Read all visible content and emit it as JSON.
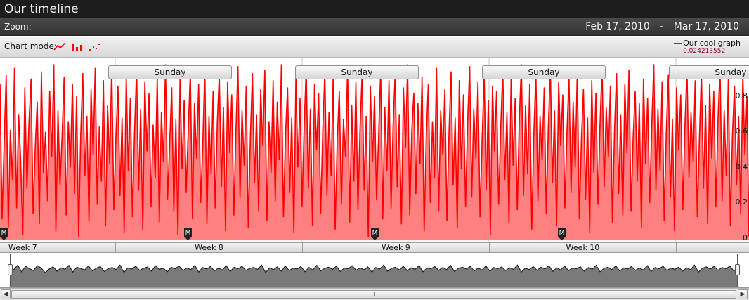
{
  "window": {
    "title": "Our timeline"
  },
  "zoom": {
    "label": "Zoom:",
    "range_start": "Feb 17, 2010",
    "range_separator": "-",
    "range_end": "Mar 17, 2010"
  },
  "chart_mode": {
    "label": "Chart mode:",
    "modes": [
      {
        "name": "line",
        "icon": "line-chart-icon"
      },
      {
        "name": "bar",
        "icon": "bar-chart-icon"
      },
      {
        "name": "scatter",
        "icon": "scatter-chart-icon"
      }
    ]
  },
  "legend": {
    "series_name": "Our cool graph",
    "current_value": "0.024213552",
    "color": "#ff0000"
  },
  "day_labels": [
    "Sunday",
    "Sunday",
    "Sunday",
    "Sunday"
  ],
  "week_labels": [
    "Week 7",
    "Week 8",
    "Week 9",
    "Week 10"
  ],
  "colors": {
    "line": "#ff0000",
    "fill": "#ff8080",
    "overview_fill": "#7a7a7a",
    "title_bg": "#1d1d1d"
  },
  "chart_data": {
    "type": "area",
    "title": "",
    "xlabel": "",
    "ylabel": "",
    "x_range": [
      "Feb 17, 2010",
      "Mar 17, 2010"
    ],
    "ylim": [
      0,
      1
    ],
    "y_ticks": [
      0,
      0.2,
      0.4,
      0.6,
      0.8
    ],
    "y_tick_labels": [
      "0",
      "0.2",
      "0.4",
      "0.6",
      "0.8"
    ],
    "grid": true,
    "series": [
      {
        "name": "Our cool graph",
        "values": [
          0.88,
          0.12,
          0.55,
          0.93,
          0.07,
          0.62,
          0.34,
          0.97,
          0.18,
          0.71,
          0.45,
          0.03,
          0.86,
          0.29,
          0.66,
          0.91,
          0.15,
          0.52,
          0.78,
          0.09,
          0.95,
          0.38,
          0.61,
          0.22,
          0.84,
          0.47,
          0.99,
          0.05,
          0.73,
          0.31,
          0.58,
          0.92,
          0.14,
          0.67,
          0.41,
          0.88,
          0.26,
          0.81,
          0.02,
          0.59,
          0.94,
          0.36,
          0.7,
          0.11,
          0.85,
          0.48,
          0.97,
          0.2,
          0.64,
          0.33,
          0.9,
          0.08,
          0.76,
          0.43,
          0.98,
          0.17,
          0.57,
          0.87,
          0.25,
          0.69,
          0.04,
          0.93,
          0.39,
          0.8,
          0.13,
          0.6,
          0.96,
          0.28,
          0.74,
          0.06,
          0.89,
          0.5,
          0.83,
          0.19,
          0.65,
          0.35,
          0.92,
          0.1,
          0.72,
          0.44,
          0.99,
          0.23,
          0.55,
          0.86,
          0.16,
          0.68,
          0.03,
          0.91,
          0.4,
          0.79,
          0.27,
          0.63,
          0.95,
          0.12,
          0.77,
          0.46,
          0.88,
          0.21,
          0.54,
          0.97,
          0.09,
          0.7,
          0.37,
          0.84,
          0.18,
          0.66,
          0.93,
          0.3,
          0.75,
          0.05,
          0.89,
          0.49,
          0.82,
          0.14,
          0.61,
          0.98,
          0.24,
          0.73,
          0.42,
          0.87,
          0.07,
          0.58,
          0.94,
          0.32,
          0.71,
          0.16,
          0.85,
          0.53,
          0.96,
          0.11,
          0.67,
          0.38,
          0.9,
          0.22,
          0.78,
          0.45,
          0.99,
          0.13,
          0.6,
          0.86,
          0.27,
          0.69,
          0.04,
          0.92,
          0.41,
          0.8,
          0.19,
          0.64,
          0.97,
          0.29,
          0.74,
          0.08,
          0.88,
          0.51,
          0.83,
          0.15,
          0.62,
          0.95,
          0.25,
          0.72,
          0.36,
          0.91,
          0.06,
          0.57,
          0.84,
          0.2,
          0.68,
          0.47,
          0.98,
          0.1,
          0.76,
          0.33,
          0.89,
          0.17,
          0.63,
          0.93,
          0.28,
          0.7,
          0.02,
          0.87,
          0.44,
          0.81,
          0.23,
          0.59,
          0.96,
          0.12,
          0.75,
          0.39,
          0.9,
          0.18,
          0.65,
          0.94,
          0.3,
          0.71,
          0.09,
          0.86,
          0.52,
          0.99,
          0.14,
          0.61,
          0.83,
          0.26,
          0.77,
          0.43,
          0.92,
          0.05,
          0.58,
          0.88,
          0.21,
          0.67,
          0.35,
          0.97,
          0.16,
          0.73,
          0.48,
          0.85,
          0.11,
          0.6,
          0.95,
          0.31,
          0.69,
          0.07,
          0.9,
          0.4,
          0.82,
          0.19,
          0.66,
          0.98,
          0.24,
          0.74,
          0.46,
          0.89,
          0.13,
          0.56,
          0.93,
          0.28,
          0.79,
          0.03,
          0.87,
          0.5,
          0.84,
          0.2,
          0.63,
          0.96,
          0.34,
          0.72,
          0.1,
          0.91,
          0.42,
          0.8,
          0.17,
          0.68,
          0.99,
          0.25,
          0.76,
          0.37,
          0.88,
          0.06,
          0.59,
          0.94,
          0.22,
          0.7,
          0.45,
          0.86,
          0.15,
          0.64,
          0.97,
          0.32,
          0.73,
          0.08,
          0.89,
          0.53,
          0.82,
          0.18,
          0.61,
          0.92,
          0.27,
          0.78,
          0.41,
          0.95,
          0.12,
          0.57,
          0.85,
          0.23,
          0.69,
          0.04,
          0.9,
          0.38,
          0.83,
          0.2,
          0.66,
          0.98,
          0.3,
          0.75,
          0.47,
          0.87,
          0.1,
          0.62,
          0.94,
          0.26,
          0.71,
          0.14,
          0.88,
          0.49,
          0.96,
          0.16,
          0.58,
          0.84,
          0.33,
          0.77,
          0.07,
          0.91,
          0.43,
          0.8,
          0.21,
          0.65,
          0.99,
          0.28,
          0.74,
          0.39,
          0.89,
          0.11,
          0.6,
          0.93,
          0.24,
          0.68,
          0.05,
          0.86,
          0.51,
          0.82,
          0.17,
          0.63,
          0.97,
          0.35,
          0.72,
          0.44,
          0.9,
          0.13,
          0.56,
          0.95,
          0.29,
          0.76,
          0.09,
          0.88,
          0.46,
          0.84,
          0.19,
          0.67,
          0.98,
          0.22,
          0.73,
          0.36,
          0.92,
          0.08,
          0.59,
          0.87,
          0.31,
          0.7,
          0.15,
          0.94,
          0.48,
          0.81,
          0.02
        ]
      }
    ],
    "overview_values": [
      0.62,
      0.55,
      0.7,
      0.48,
      0.66,
      0.58,
      0.52,
      0.68,
      0.6,
      0.45,
      0.57,
      0.64,
      0.5,
      0.61,
      0.56,
      0.69,
      0.47,
      0.63,
      0.59,
      0.54,
      0.67,
      0.51,
      0.6,
      0.65,
      0.49,
      0.58,
      0.62,
      0.55,
      0.7,
      0.46,
      0.61,
      0.57,
      0.66,
      0.53,
      0.59,
      0.64,
      0.5,
      0.68,
      0.56,
      0.6,
      0.48,
      0.63,
      0.58,
      0.67,
      0.52,
      0.61,
      0.55,
      0.69,
      0.47,
      0.62,
      0.57,
      0.65,
      0.51,
      0.6,
      0.54,
      0.68,
      0.49,
      0.63,
      0.58,
      0.66,
      0.53,
      0.59,
      0.62,
      0.56,
      0.7,
      0.46,
      0.61,
      0.55,
      0.64,
      0.5,
      0.67,
      0.52,
      0.6,
      0.57,
      0.65,
      0.48,
      0.62,
      0.54,
      0.69,
      0.51,
      0.59,
      0.63,
      0.56,
      0.66,
      0.49,
      0.6,
      0.58,
      0.68,
      0.53,
      0.61,
      0.55,
      0.64,
      0.47,
      0.62,
      0.57,
      0.7,
      0.5,
      0.59,
      0.63,
      0.54,
      0.66,
      0.52,
      0.61,
      0.56,
      0.68,
      0.48,
      0.6,
      0.58,
      0.65,
      0.53,
      0.62,
      0.55,
      0.69,
      0.49,
      0.59,
      0.63,
      0.57,
      0.66,
      0.51,
      0.6,
      0.54,
      0.67,
      0.5,
      0.62,
      0.58,
      0.64,
      0.52,
      0.61,
      0.56,
      0.7,
      0.47,
      0.6,
      0.55,
      0.65,
      0.53,
      0.63,
      0.57,
      0.68,
      0.49,
      0.61,
      0.54,
      0.66,
      0.52,
      0.6,
      0.58,
      0.64,
      0.5,
      0.62,
      0.56,
      0.69,
      0.48,
      0.59,
      0.63,
      0.55,
      0.67,
      0.51,
      0.61,
      0.57,
      0.65,
      0.53,
      0.6,
      0.54,
      0.68,
      0.49,
      0.62,
      0.58,
      0.66,
      0.52,
      0.6,
      0.56,
      0.63,
      0.5,
      0.61,
      0.55,
      0.7,
      0.47,
      0.59,
      0.64,
      0.57,
      0.66,
      0.53,
      0.62,
      0.58,
      0.67,
      0.51,
      0.6
    ]
  }
}
